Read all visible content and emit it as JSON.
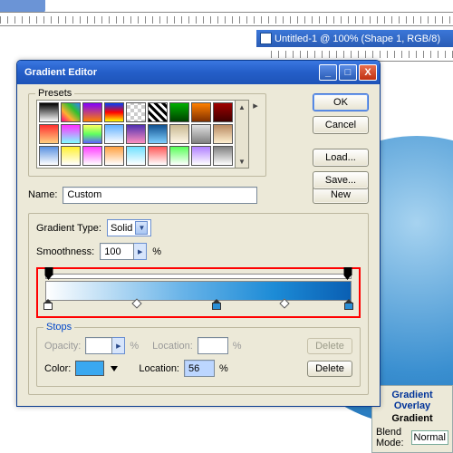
{
  "doc_window": {
    "title": "Untitled-1 @ 100% (Shape 1, RGB/8)"
  },
  "dialog": {
    "title": "Gradient Editor",
    "buttons": {
      "ok": "OK",
      "cancel": "Cancel",
      "load": "Load...",
      "save": "Save...",
      "new": "New"
    },
    "presets_label": "Presets",
    "name_label": "Name:",
    "name_value": "Custom",
    "gradient_type_label": "Gradient Type:",
    "gradient_type_value": "Solid",
    "smoothness_label": "Smoothness:",
    "smoothness_value": "100",
    "percent": "%",
    "stops": {
      "label": "Stops",
      "opacity_label": "Opacity:",
      "opacity_location_label": "Location:",
      "color_label": "Color:",
      "color_location_label": "Location:",
      "color_location_value": "56",
      "delete": "Delete"
    },
    "preset_swatches": [
      "linear-gradient(#000,#fff)",
      "linear-gradient(45deg,#ff0080,#ffb030,#30c030,#3080ff)",
      "linear-gradient(#8000ff,#ff8000)",
      "linear-gradient(#0040ff,#ff0000,#ffff00)",
      "repeating-conic-gradient(#ccc 0 25%,#fff 0 50%) 0/8px 8px",
      "repeating-linear-gradient(45deg,#000 0 3px,#fff 3px 6px)",
      "linear-gradient(#00b000,#004000)",
      "linear-gradient(#ff8000,#803000)",
      "linear-gradient(#a00000,#400000)",
      "linear-gradient(#ff3030,#ffd080)",
      "linear-gradient(#ff30ff,#80ffff)",
      "linear-gradient(#ffff60,#60ff60,#6060ff)",
      "linear-gradient(#60b0ff,#ffffff)",
      "linear-gradient(#5030b0,#ff90c0)",
      "linear-gradient(#105090,#80d0ff)",
      "linear-gradient(#c8b890,#fff8e8)",
      "linear-gradient(#e0e0e0,#808080)",
      "linear-gradient(#b88860,#fff0d0)",
      "linear-gradient(#5890e0,#fff)",
      "linear-gradient(#fff030,#fff)",
      "linear-gradient(#ff40ff,#fff)",
      "linear-gradient(#ffa040,#fff)",
      "linear-gradient(#70e0ff,#fff)",
      "linear-gradient(#ff5858,#fff)",
      "linear-gradient(#58ff58,#fff)",
      "linear-gradient(#b080ff,#fff)",
      "linear-gradient(#808080,#fff)"
    ]
  },
  "gradient_overlay_panel": {
    "title": "Gradient Overlay",
    "subtitle": "Gradient",
    "blend_mode_label": "Blend Mode:",
    "blend_mode_value": "Normal"
  }
}
